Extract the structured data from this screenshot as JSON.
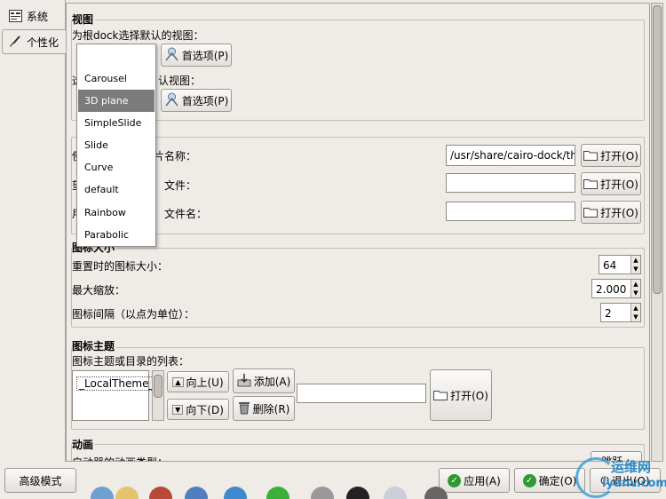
{
  "tabs": [
    {
      "label": "系统",
      "icon": "system-icon"
    },
    {
      "label": "个性化",
      "icon": "brush-icon"
    }
  ],
  "view_section": {
    "title": "视图",
    "root_dock_label": "为根dock选择默认的视图：",
    "prefs_button_1": "首选项(P)",
    "sub_dock_label": "选择默认的子dock视图：",
    "sub_dock_label_visible": "认视图：",
    "prefs_button_2": "首选项(P)"
  },
  "view_menu": {
    "items": [
      "Carousel",
      "3D plane",
      "SimpleSlide",
      "Slide",
      "Curve",
      "default",
      "Rainbow",
      "Parabolic"
    ],
    "selected": "3D plane"
  },
  "image_section": {
    "row1_label": "片名称：",
    "row1_value": "/usr/share/cairo-dock/the",
    "row2_label": "文件：",
    "row2_value": "",
    "row3_label": "文件名：",
    "row3_value": "",
    "open_button": "打开(O)"
  },
  "size_section": {
    "title": "图标大小",
    "reset_size_label": "重置时的图标大小：",
    "reset_size_value": "64",
    "max_zoom_label": "最大缩放：",
    "max_zoom_value": "2.000",
    "spacing_label": "图标间隔（以点为单位）：",
    "spacing_value": "2"
  },
  "theme_section": {
    "title": "图标主题",
    "list_label": "图标主题或目录的列表：",
    "list_item": "_LocalTheme_",
    "up_button": "向上(U)",
    "down_button": "向下(D)",
    "add_button": "添加(A)",
    "remove_button": "删除(R)",
    "entry_value": "",
    "open_button": "打开(O)"
  },
  "anim_section": {
    "title": "动画",
    "row_label": "启动器的动画类型：",
    "combo_value": "跳跃"
  },
  "bottom": {
    "advanced_button": "高级模式",
    "apply_button": "应用(A)",
    "ok_button": "确定(O)",
    "quit_button": "退出(Q)"
  },
  "watermark": {
    "line1": "运维网",
    "line2": "iyunv.com"
  }
}
